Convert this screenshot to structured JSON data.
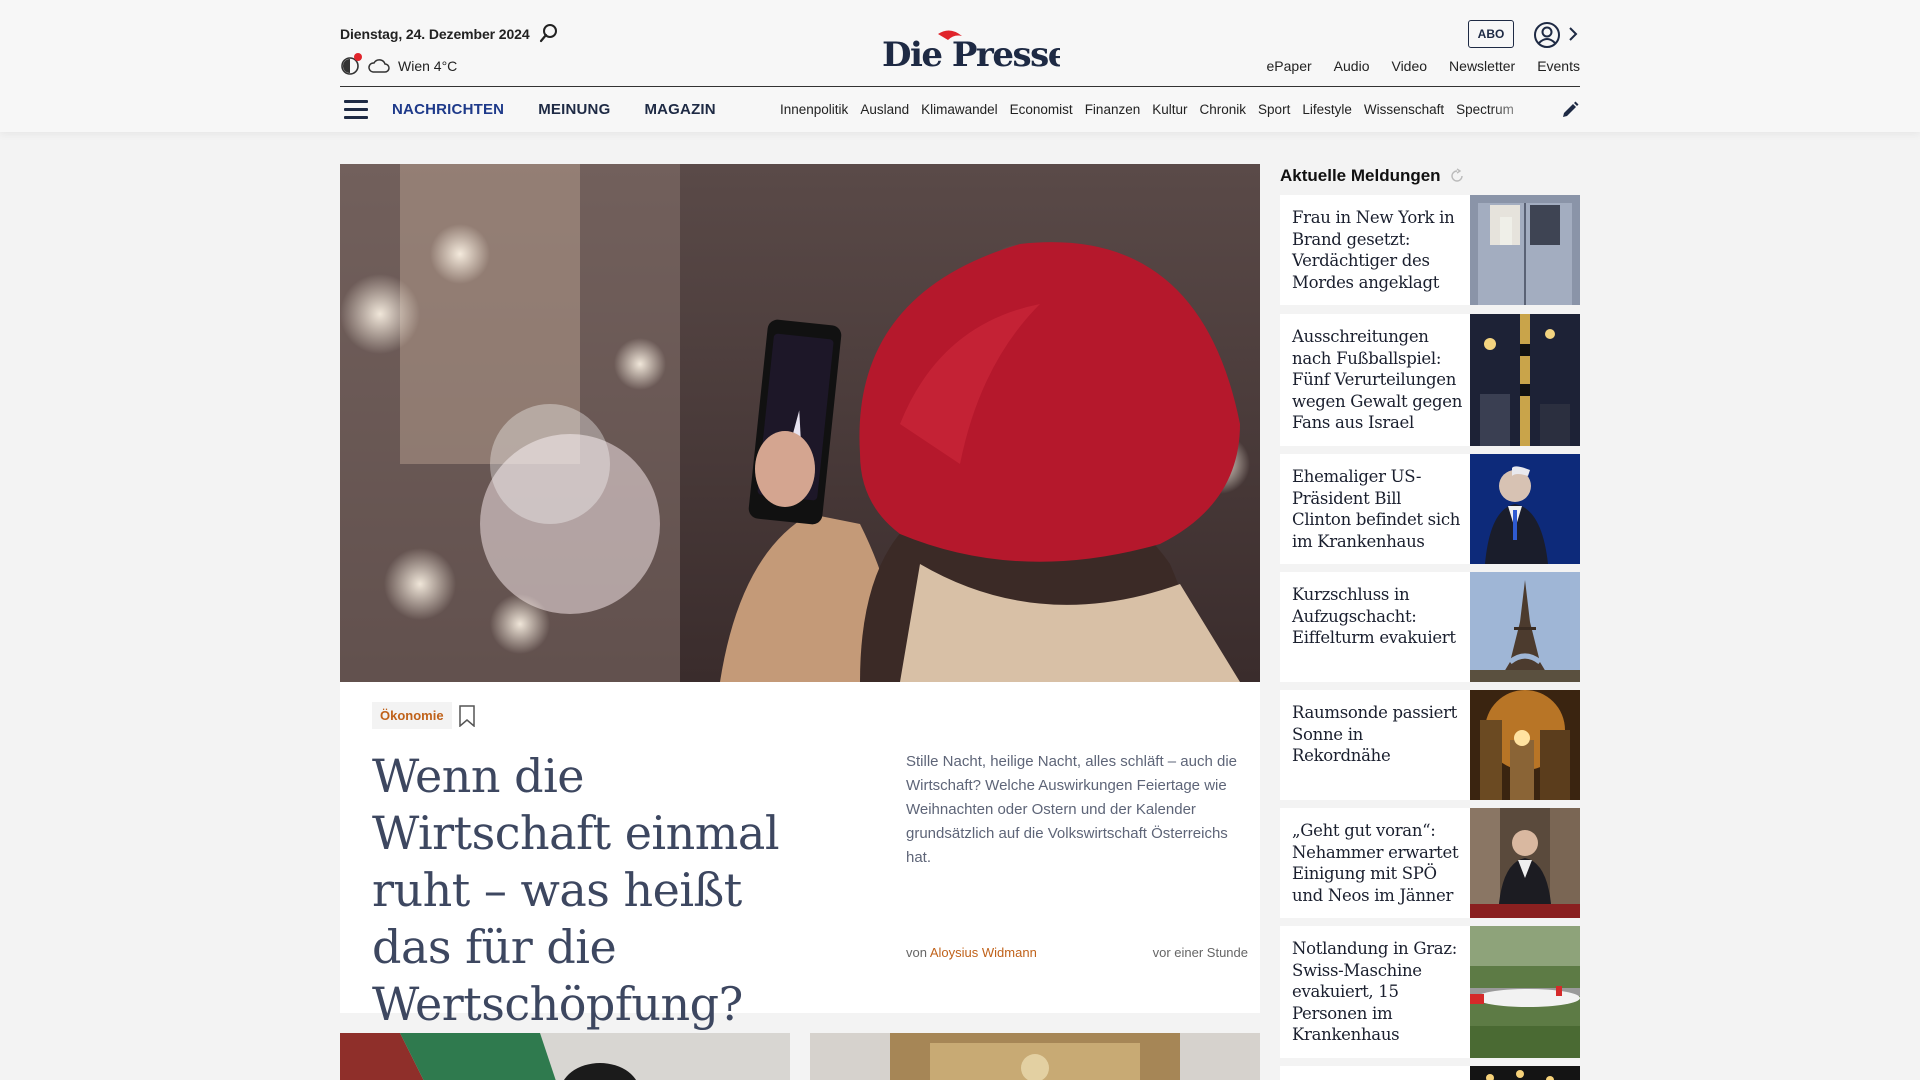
{
  "header": {
    "date": "Dienstag, 24. Dezember 2024",
    "weather": "Wien 4°C",
    "logo": "Die Presse",
    "abo_label": "ABO",
    "top_links": [
      "ePaper",
      "Audio",
      "Video",
      "Newsletter",
      "Events"
    ],
    "main_nav": [
      "NACHRICHTEN",
      "MEINUNG",
      "MAGAZIN"
    ],
    "sub_nav": [
      "Innenpolitik",
      "Ausland",
      "Klimawandel",
      "Economist",
      "Finanzen",
      "Kultur",
      "Chronik",
      "Sport",
      "Lifestyle",
      "Wissenschaft",
      "Spectrum"
    ]
  },
  "hero": {
    "tag": "Ökonomie",
    "title": "Wenn die Wirtschaft einmal ruht – was heißt das für die Wertschöpfung?",
    "lead": "Stille Nacht, heilige Nacht, alles schläft – auch die Wirtschaft? Welche Auswirkungen Feiertage wie Weihnachten oder Ostern und der Kalender grundsätzlich auf die Volkswirtschaft Österreichs hat.",
    "byline_prefix": "von",
    "author": "Aloysius Widmann",
    "time": "vor einer Stunde"
  },
  "sidebar": {
    "title": "Aktuelle Meldungen",
    "items": [
      {
        "title": "Frau in New York in Brand gesetzt: Verdächtiger des Mordes angeklagt"
      },
      {
        "title": "Ausschreitungen nach Fußballspiel: Fünf Verurteilungen wegen Gewalt gegen Fans aus Israel"
      },
      {
        "title": "Ehemaliger US-Präsident Bill Clinton befindet sich im Krankenhaus"
      },
      {
        "title": "Kurzschluss in Aufzugschacht: Eiffelturm evakuiert"
      },
      {
        "title": "Raumsonde passiert Sonne in Rekordnähe"
      },
      {
        "title": "„Geht gut voran“: Nehammer erwartet Einigung mit SPÖ und Neos im Jänner"
      },
      {
        "title": "Notlandung in Graz: Swiss-Maschine evakuiert, 15 Personen im Krankenhaus"
      }
    ]
  },
  "colors": {
    "accent": "#c0621a",
    "navy": "#1e2a44",
    "headline": "#3d4760",
    "brand_red": "#e0242b"
  }
}
